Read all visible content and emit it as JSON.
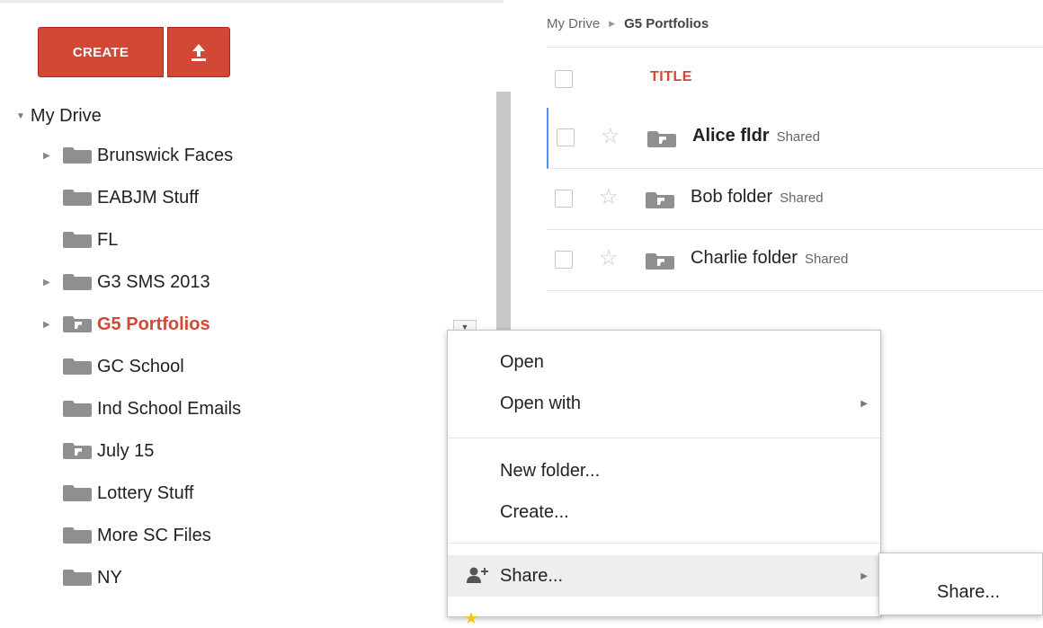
{
  "sidebar": {
    "create_label": "CREATE",
    "upload_icon": "upload-arrow-icon",
    "root_label": "My Drive",
    "folders": [
      {
        "label": "Brunswick Faces",
        "expandable": true,
        "shared": false,
        "active": false
      },
      {
        "label": "EABJM Stuff",
        "expandable": false,
        "shared": false,
        "active": false
      },
      {
        "label": "FL",
        "expandable": false,
        "shared": false,
        "active": false
      },
      {
        "label": "G3 SMS 2013",
        "expandable": true,
        "shared": false,
        "active": false
      },
      {
        "label": "G5 Portfolios",
        "expandable": true,
        "shared": true,
        "active": true
      },
      {
        "label": "GC School",
        "expandable": false,
        "shared": false,
        "active": false
      },
      {
        "label": "Ind School Emails",
        "expandable": false,
        "shared": false,
        "active": false
      },
      {
        "label": "July 15",
        "expandable": false,
        "shared": true,
        "active": false
      },
      {
        "label": "Lottery Stuff",
        "expandable": false,
        "shared": false,
        "active": false
      },
      {
        "label": "More SC Files",
        "expandable": false,
        "shared": false,
        "active": false
      },
      {
        "label": "NY",
        "expandable": false,
        "shared": false,
        "active": false
      }
    ]
  },
  "breadcrumb": {
    "root": "My Drive",
    "current": "G5 Portfolios"
  },
  "list": {
    "title_header": "TITLE",
    "rows": [
      {
        "name": "Alice fldr",
        "status": "Shared",
        "selected": true
      },
      {
        "name": "Bob folder",
        "status": "Shared",
        "selected": false
      },
      {
        "name": "Charlie folder",
        "status": "Shared",
        "selected": false
      }
    ]
  },
  "context_menu": {
    "open": "Open",
    "open_with": "Open with",
    "new_folder": "New folder...",
    "create": "Create...",
    "share": "Share...",
    "submenu_share": "Share..."
  },
  "colors": {
    "accent": "#d14836",
    "selection": "#4d90fe",
    "folder_gray": "#8f8f8f"
  }
}
